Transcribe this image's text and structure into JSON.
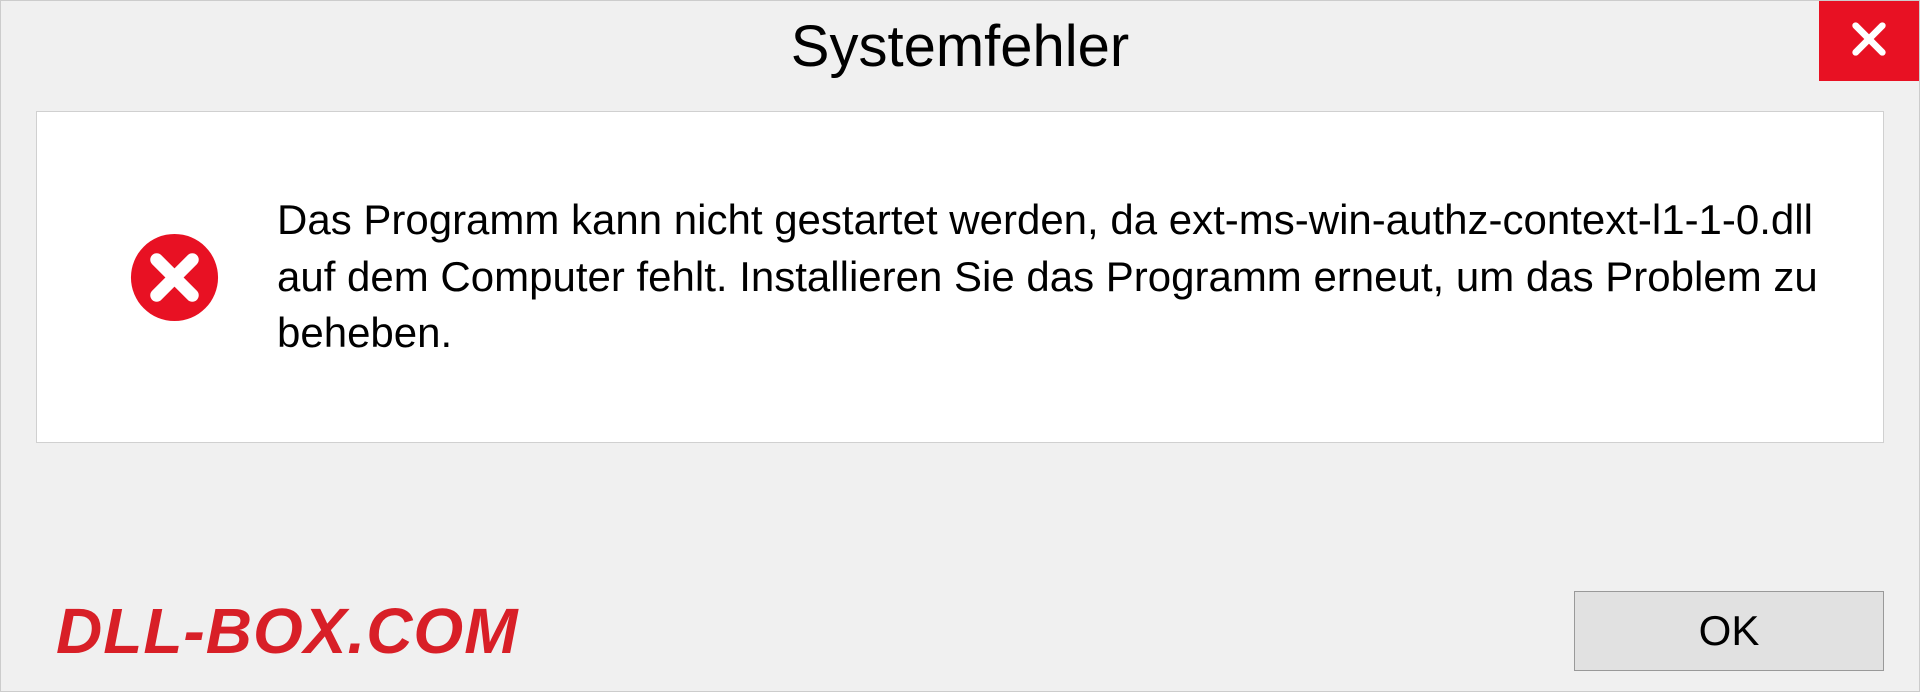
{
  "dialog": {
    "title": "Systemfehler",
    "message": "Das Programm kann nicht gestartet werden, da ext-ms-win-authz-context-l1-1-0.dll auf dem Computer fehlt. Installieren Sie das Programm erneut, um das Problem zu beheben.",
    "ok_label": "OK"
  },
  "watermark": {
    "text": "DLL-BOX.COM"
  },
  "colors": {
    "close_bg": "#e81123",
    "error_icon": "#e81123",
    "watermark": "#d81f27"
  }
}
